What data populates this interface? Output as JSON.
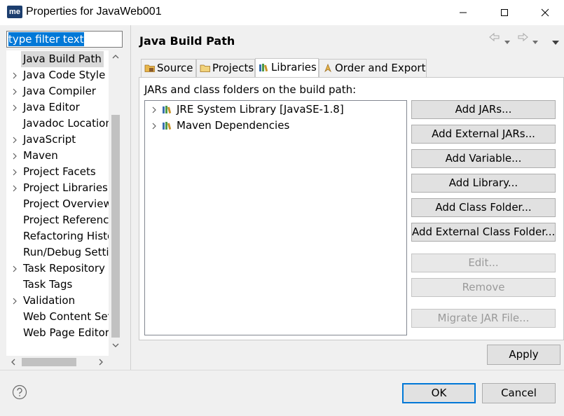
{
  "window": {
    "app_icon_text": "me",
    "title": "Properties for JavaWeb001"
  },
  "filter": {
    "value": "type filter text"
  },
  "nav": {
    "items": [
      {
        "label": "Java Build Path",
        "expandable": false,
        "selected": true
      },
      {
        "label": "Java Code Style",
        "expandable": true
      },
      {
        "label": "Java Compiler",
        "expandable": true
      },
      {
        "label": "Java Editor",
        "expandable": true
      },
      {
        "label": "Javadoc Location",
        "expandable": false
      },
      {
        "label": "JavaScript",
        "expandable": true
      },
      {
        "label": "Maven",
        "expandable": true
      },
      {
        "label": "Project Facets",
        "expandable": true
      },
      {
        "label": "Project Libraries",
        "expandable": true
      },
      {
        "label": "Project Overview",
        "expandable": false
      },
      {
        "label": "Project References",
        "expandable": false
      },
      {
        "label": "Refactoring History",
        "expandable": false
      },
      {
        "label": "Run/Debug Settings",
        "expandable": false
      },
      {
        "label": "Task Repository",
        "expandable": true
      },
      {
        "label": "Task Tags",
        "expandable": false
      },
      {
        "label": "Validation",
        "expandable": true
      },
      {
        "label": "Web Content Settings",
        "expandable": false
      },
      {
        "label": "Web Page Editor",
        "expandable": false
      }
    ]
  },
  "page": {
    "title": "Java Build Path",
    "tabs": [
      {
        "label": "Source",
        "icon": "source-folder-icon",
        "active": false
      },
      {
        "label": "Projects",
        "icon": "projects-folder-icon",
        "active": false
      },
      {
        "label": "Libraries",
        "icon": "libraries-icon",
        "active": true
      },
      {
        "label": "Order and Export",
        "icon": "order-export-icon",
        "active": false
      }
    ],
    "list_label": "JARs and class folders on the build path:",
    "libraries": [
      {
        "label": "JRE System Library [JavaSE-1.8]"
      },
      {
        "label": "Maven Dependencies"
      }
    ],
    "buttons": [
      {
        "label": "Add JARs...",
        "enabled": true
      },
      {
        "label": "Add External JARs...",
        "enabled": true
      },
      {
        "label": "Add Variable...",
        "enabled": true
      },
      {
        "label": "Add Library...",
        "enabled": true
      },
      {
        "label": "Add Class Folder...",
        "enabled": true
      },
      {
        "label": "Add External Class Folder...",
        "enabled": true
      },
      {
        "label": "Edit...",
        "enabled": false
      },
      {
        "label": "Remove",
        "enabled": false
      },
      {
        "label": "Migrate JAR File...",
        "enabled": false
      }
    ]
  },
  "footer": {
    "apply": "Apply",
    "ok": "OK",
    "cancel": "Cancel"
  },
  "colors": {
    "selection": "#0078d7",
    "default_button_border": "#0078d7"
  }
}
